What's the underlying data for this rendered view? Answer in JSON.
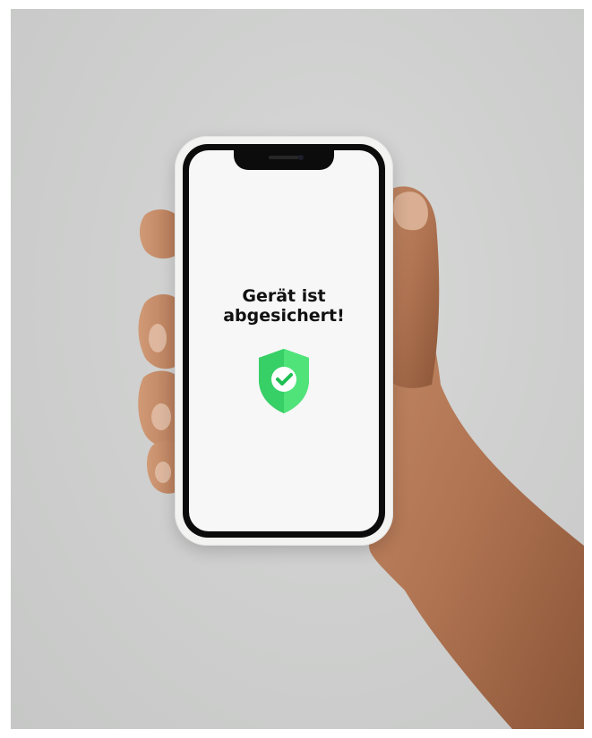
{
  "screen": {
    "message_line1": "Gerät ist",
    "message_line2": "abgesichert!",
    "icon": "shield-check-icon"
  },
  "colors": {
    "shield_light": "#4fe37a",
    "shield_dark": "#1fbf54",
    "background": "#cfd0cf",
    "phone_frame": "#f3f3f2"
  }
}
